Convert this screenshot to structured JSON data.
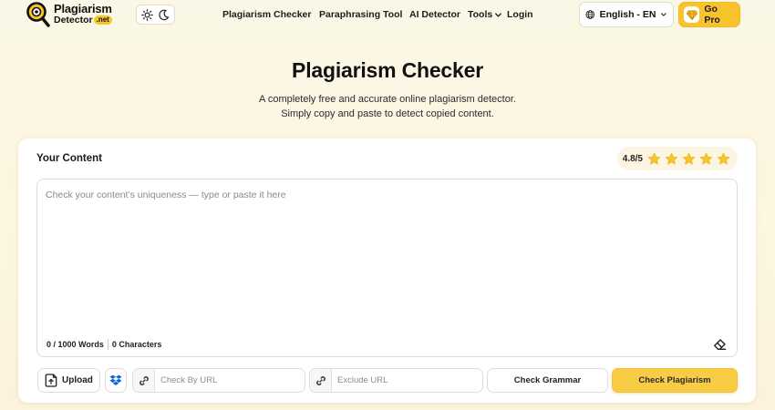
{
  "brand": {
    "line1": "Plagiarism",
    "line2": "Detector",
    "badge": ".net"
  },
  "theme_toggle": {
    "light_icon": "sun-icon",
    "dark_icon": "moon-icon"
  },
  "nav": {
    "items": [
      {
        "label": "Plagiarism Checker"
      },
      {
        "label": "Paraphrasing Tool"
      },
      {
        "label": "AI Detector"
      },
      {
        "label": "Tools"
      },
      {
        "label": "Login"
      }
    ]
  },
  "language": {
    "label": "English - EN",
    "icon": "globe-icon"
  },
  "gopro": {
    "label": "Go Pro",
    "icon": "diamond-icon"
  },
  "hero": {
    "title": "Plagiarism Checker",
    "subtitle_line1": "A completely free and accurate online plagiarism detector.",
    "subtitle_line2": "Simply copy and paste to detect copied content."
  },
  "card": {
    "title": "Your Content",
    "rating": {
      "value": "4.8/5",
      "stars": 5
    }
  },
  "editor": {
    "placeholder": "Check your content’s uniqueness — type or paste it here",
    "value": "",
    "word_count": "0 / 1000 Words",
    "char_count": "0 Characters"
  },
  "toolbar": {
    "upload_label": "Upload",
    "url_placeholder": "Check By URL",
    "exclude_placeholder": "Exclude URL",
    "grammar_label": "Check Grammar",
    "check_label": "Check Plagiarism"
  },
  "colors": {
    "accent": "#f7c42e",
    "background": "#fbf6e2",
    "text": "#111111"
  }
}
